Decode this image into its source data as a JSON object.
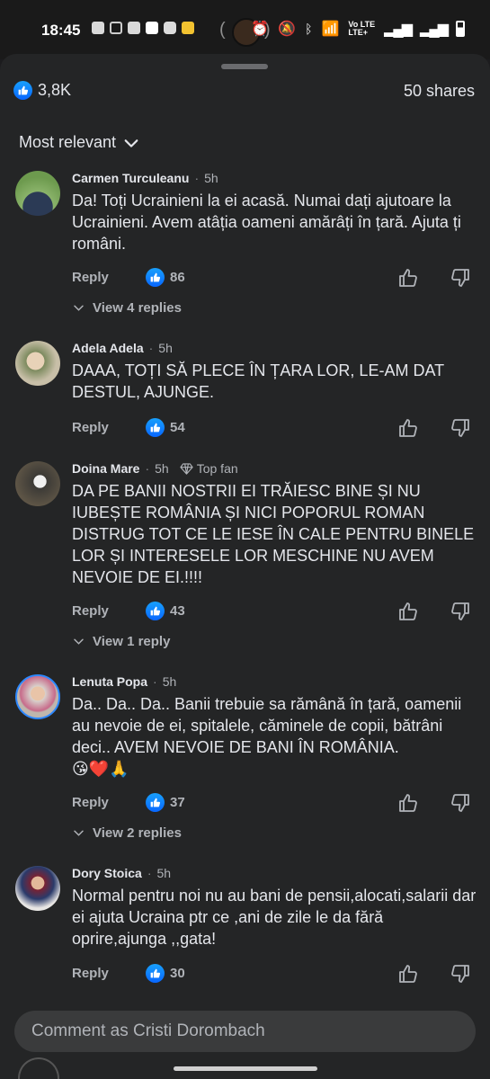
{
  "status_bar": {
    "time": "18:45",
    "network": "Vo LTE",
    "network_sub": "LTE+"
  },
  "header": {
    "reaction_count": "3,8K",
    "shares": "50 shares",
    "sort_label": "Most relevant"
  },
  "colors": {
    "background": "#242526",
    "accent": "#0866ff",
    "text": "#e4e6eb",
    "muted": "#b0b3b8"
  },
  "comments": [
    {
      "author": "Carmen Turculeanu",
      "time": "5h",
      "badge": "",
      "text": "Da! Toți Ucrainieni la ei acasă. Numai dați ajutoare la Ucrainieni. Avem atâția oameni amărâți în țară. Ajuta ți români.",
      "reply_label": "Reply",
      "likes": "86",
      "view_replies": "View 4 replies"
    },
    {
      "author": "Adela Adela",
      "time": "5h",
      "badge": "",
      "text": "DAAA, TOȚI SĂ PLECE ÎN ȚARA LOR, LE-AM DAT DESTUL, AJUNGE.",
      "reply_label": "Reply",
      "likes": "54",
      "view_replies": ""
    },
    {
      "author": "Doina Mare",
      "time": "5h",
      "badge": "Top fan",
      "text": "DA PE BANII NOSTRII EI TRĂIESC BINE ȘI NU IUBEȘTE ROMÂNIA ȘI NICI POPORUL ROMAN DISTRUG TOT CE LE IESE ÎN CALE PENTRU BINELE LOR ȘI INTERESELE LOR MESCHINE  NU AVEM NEVOIE DE EI.!!!!",
      "reply_label": "Reply",
      "likes": "43",
      "view_replies": "View 1 reply"
    },
    {
      "author": "Lenuta Popa",
      "time": "5h",
      "badge": "",
      "text": "Da.. Da.. Da.. Banii trebuie sa rămână în țară, oamenii au nevoie de ei, spitalele, căminele de copii, bătrâni deci.. AVEM NEVOIE DE BANI ÎN ROMÂNIA.",
      "emoji": "😘❤️🙏",
      "reply_label": "Reply",
      "likes": "37",
      "view_replies": "View 2 replies"
    },
    {
      "author": "Dory Stoica",
      "time": "5h",
      "badge": "",
      "text": "Normal pentru noi nu au bani de pensii,alocati,salarii dar ei ajuta Ucraina ptr ce ,ani de zile le da fără oprire,ajunga ,,gata!",
      "reply_label": "Reply",
      "likes": "30",
      "view_replies": ""
    }
  ],
  "composer": {
    "placeholder": "Comment as Cristi Dorombach"
  }
}
